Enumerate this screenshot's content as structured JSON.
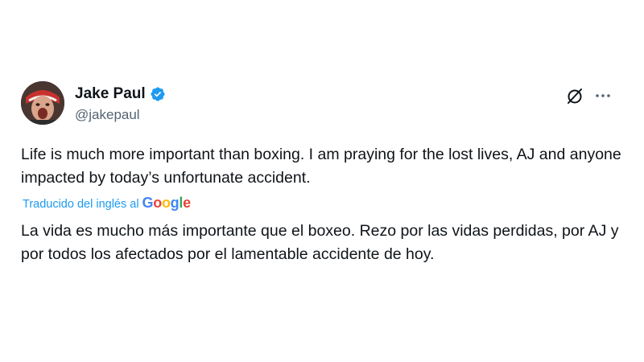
{
  "author": {
    "display_name": "Jake Paul",
    "handle": "@jakepaul",
    "verified_icon": "verified-badge-icon",
    "verified_color": "#1d9bf0"
  },
  "actions": {
    "grok_icon": "grok-icon",
    "more_icon": "more-options-icon"
  },
  "tweet": {
    "original_text": "Life is much more important than boxing. I am praying for the lost lives, AJ and anyone impacted by today’s unfortunate accident.",
    "translation_label": "Traducido del inglés al",
    "translation_provider": {
      "letters": [
        "G",
        "o",
        "o",
        "g",
        "l",
        "e"
      ],
      "colors": [
        "#4285f4",
        "#ea4335",
        "#fbbc05",
        "#4285f4",
        "#34a853",
        "#ea4335"
      ]
    },
    "translated_text": "La vida es mucho más importante que el boxeo. Rezo por las vidas perdidas, por AJ y por todos los afectados por el lamentable accidente de hoy."
  }
}
